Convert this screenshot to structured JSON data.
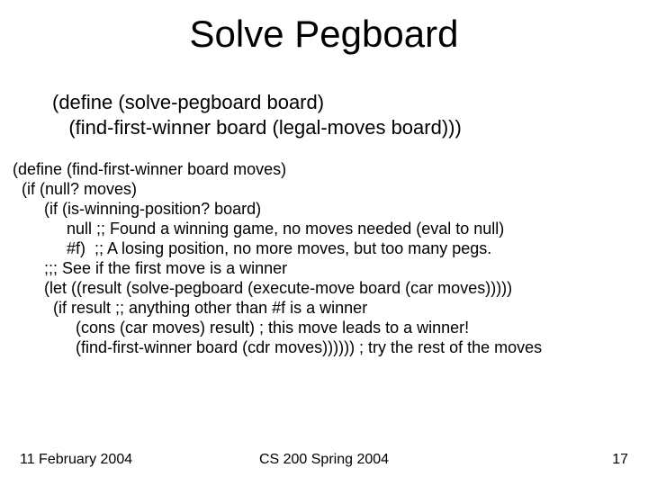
{
  "title": "Solve Pegboard",
  "code_block1_line1": "(define (solve-pegboard board)",
  "code_block1_line2": "   (find-first-winner board (legal-moves board)))",
  "code_block2_line1": "(define (find-first-winner board moves)",
  "code_block2_line2": "  (if (null? moves)",
  "code_block2_line3": "       (if (is-winning-position? board)",
  "code_block2_line4": "            null ;; Found a winning game, no moves needed (eval to null)",
  "code_block2_line5": "            #f)  ;; A losing position, no more moves, but too many pegs.",
  "code_block2_line6": "       ;;; See if the first move is a winner",
  "code_block2_line7": "       (let ((result (solve-pegboard (execute-move board (car moves)))))",
  "code_block2_line8": "         (if result ;; anything other than #f is a winner",
  "code_block2_line9": "              (cons (car moves) result) ; this move leads to a winner!",
  "code_block2_line10": "              (find-first-winner board (cdr moves)))))) ; try the rest of the moves",
  "footer": {
    "date": "11 February 2004",
    "course": "CS 200 Spring 2004",
    "page": "17"
  }
}
